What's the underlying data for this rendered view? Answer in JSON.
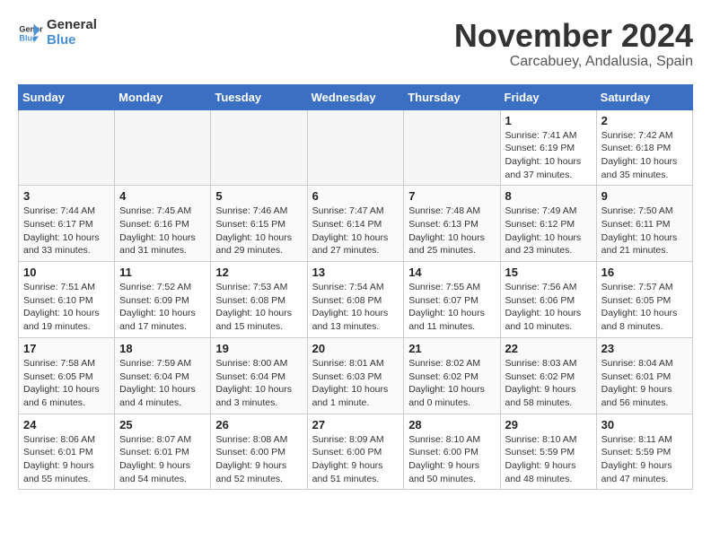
{
  "logo": {
    "line1": "General",
    "line2": "Blue"
  },
  "title": "November 2024",
  "subtitle": "Carcabuey, Andalusia, Spain",
  "weekdays": [
    "Sunday",
    "Monday",
    "Tuesday",
    "Wednesday",
    "Thursday",
    "Friday",
    "Saturday"
  ],
  "weeks": [
    [
      {
        "day": "",
        "info": ""
      },
      {
        "day": "",
        "info": ""
      },
      {
        "day": "",
        "info": ""
      },
      {
        "day": "",
        "info": ""
      },
      {
        "day": "",
        "info": ""
      },
      {
        "day": "1",
        "info": "Sunrise: 7:41 AM\nSunset: 6:19 PM\nDaylight: 10 hours\nand 37 minutes."
      },
      {
        "day": "2",
        "info": "Sunrise: 7:42 AM\nSunset: 6:18 PM\nDaylight: 10 hours\nand 35 minutes."
      }
    ],
    [
      {
        "day": "3",
        "info": "Sunrise: 7:44 AM\nSunset: 6:17 PM\nDaylight: 10 hours\nand 33 minutes."
      },
      {
        "day": "4",
        "info": "Sunrise: 7:45 AM\nSunset: 6:16 PM\nDaylight: 10 hours\nand 31 minutes."
      },
      {
        "day": "5",
        "info": "Sunrise: 7:46 AM\nSunset: 6:15 PM\nDaylight: 10 hours\nand 29 minutes."
      },
      {
        "day": "6",
        "info": "Sunrise: 7:47 AM\nSunset: 6:14 PM\nDaylight: 10 hours\nand 27 minutes."
      },
      {
        "day": "7",
        "info": "Sunrise: 7:48 AM\nSunset: 6:13 PM\nDaylight: 10 hours\nand 25 minutes."
      },
      {
        "day": "8",
        "info": "Sunrise: 7:49 AM\nSunset: 6:12 PM\nDaylight: 10 hours\nand 23 minutes."
      },
      {
        "day": "9",
        "info": "Sunrise: 7:50 AM\nSunset: 6:11 PM\nDaylight: 10 hours\nand 21 minutes."
      }
    ],
    [
      {
        "day": "10",
        "info": "Sunrise: 7:51 AM\nSunset: 6:10 PM\nDaylight: 10 hours\nand 19 minutes."
      },
      {
        "day": "11",
        "info": "Sunrise: 7:52 AM\nSunset: 6:09 PM\nDaylight: 10 hours\nand 17 minutes."
      },
      {
        "day": "12",
        "info": "Sunrise: 7:53 AM\nSunset: 6:08 PM\nDaylight: 10 hours\nand 15 minutes."
      },
      {
        "day": "13",
        "info": "Sunrise: 7:54 AM\nSunset: 6:08 PM\nDaylight: 10 hours\nand 13 minutes."
      },
      {
        "day": "14",
        "info": "Sunrise: 7:55 AM\nSunset: 6:07 PM\nDaylight: 10 hours\nand 11 minutes."
      },
      {
        "day": "15",
        "info": "Sunrise: 7:56 AM\nSunset: 6:06 PM\nDaylight: 10 hours\nand 10 minutes."
      },
      {
        "day": "16",
        "info": "Sunrise: 7:57 AM\nSunset: 6:05 PM\nDaylight: 10 hours\nand 8 minutes."
      }
    ],
    [
      {
        "day": "17",
        "info": "Sunrise: 7:58 AM\nSunset: 6:05 PM\nDaylight: 10 hours\nand 6 minutes."
      },
      {
        "day": "18",
        "info": "Sunrise: 7:59 AM\nSunset: 6:04 PM\nDaylight: 10 hours\nand 4 minutes."
      },
      {
        "day": "19",
        "info": "Sunrise: 8:00 AM\nSunset: 6:04 PM\nDaylight: 10 hours\nand 3 minutes."
      },
      {
        "day": "20",
        "info": "Sunrise: 8:01 AM\nSunset: 6:03 PM\nDaylight: 10 hours\nand 1 minute."
      },
      {
        "day": "21",
        "info": "Sunrise: 8:02 AM\nSunset: 6:02 PM\nDaylight: 10 hours\nand 0 minutes."
      },
      {
        "day": "22",
        "info": "Sunrise: 8:03 AM\nSunset: 6:02 PM\nDaylight: 9 hours\nand 58 minutes."
      },
      {
        "day": "23",
        "info": "Sunrise: 8:04 AM\nSunset: 6:01 PM\nDaylight: 9 hours\nand 56 minutes."
      }
    ],
    [
      {
        "day": "24",
        "info": "Sunrise: 8:06 AM\nSunset: 6:01 PM\nDaylight: 9 hours\nand 55 minutes."
      },
      {
        "day": "25",
        "info": "Sunrise: 8:07 AM\nSunset: 6:01 PM\nDaylight: 9 hours\nand 54 minutes."
      },
      {
        "day": "26",
        "info": "Sunrise: 8:08 AM\nSunset: 6:00 PM\nDaylight: 9 hours\nand 52 minutes."
      },
      {
        "day": "27",
        "info": "Sunrise: 8:09 AM\nSunset: 6:00 PM\nDaylight: 9 hours\nand 51 minutes."
      },
      {
        "day": "28",
        "info": "Sunrise: 8:10 AM\nSunset: 6:00 PM\nDaylight: 9 hours\nand 50 minutes."
      },
      {
        "day": "29",
        "info": "Sunrise: 8:10 AM\nSunset: 5:59 PM\nDaylight: 9 hours\nand 48 minutes."
      },
      {
        "day": "30",
        "info": "Sunrise: 8:11 AM\nSunset: 5:59 PM\nDaylight: 9 hours\nand 47 minutes."
      }
    ]
  ]
}
